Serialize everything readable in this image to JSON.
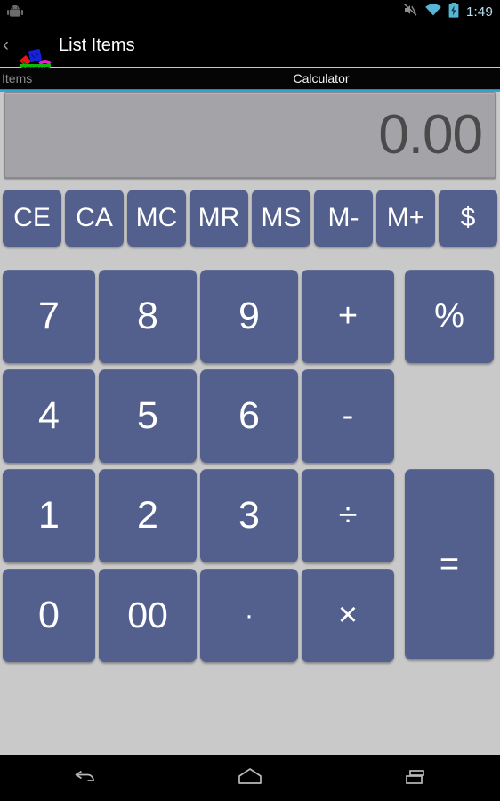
{
  "statusbar": {
    "left_icon": "android-robot-icon",
    "icons": [
      "mute-icon",
      "wifi-icon",
      "battery-charging-icon"
    ],
    "clock": "1:49",
    "clock_color": "#b6e3f5"
  },
  "actionbar": {
    "up_caret": "‹",
    "app_icon": "shopping-basket-icon",
    "title": "List Items",
    "accent_color": "#2ba6d8"
  },
  "tabs": [
    {
      "label": "Items",
      "selected": false
    },
    {
      "label": "Calculator",
      "selected": true
    }
  ],
  "display": {
    "value": "0.00",
    "background": "#a4a4a8",
    "text_color": "#4a4a4a"
  },
  "theme": {
    "button_color": "#535f8c",
    "button_text_color": "#ffffff",
    "page_background": "#c9c9c9"
  },
  "memory_row": [
    {
      "label": "CE",
      "name": "clear-entry-button"
    },
    {
      "label": "CA",
      "name": "clear-all-button"
    },
    {
      "label": "MC",
      "name": "memory-clear-button"
    },
    {
      "label": "MR",
      "name": "memory-recall-button"
    },
    {
      "label": "MS",
      "name": "memory-store-button"
    },
    {
      "label": "M-",
      "name": "memory-subtract-button"
    },
    {
      "label": "M+",
      "name": "memory-add-button"
    },
    {
      "label": "$",
      "name": "currency-button"
    }
  ],
  "keypad": [
    {
      "label": "7",
      "name": "digit-7-button"
    },
    {
      "label": "8",
      "name": "digit-8-button"
    },
    {
      "label": "9",
      "name": "digit-9-button"
    },
    {
      "label": "+",
      "name": "plus-button"
    },
    {
      "label": "%",
      "name": "percent-button"
    },
    {
      "label": "4",
      "name": "digit-4-button"
    },
    {
      "label": "5",
      "name": "digit-5-button"
    },
    {
      "label": "6",
      "name": "digit-6-button"
    },
    {
      "label": "-",
      "name": "minus-button"
    },
    {
      "label": "1",
      "name": "digit-1-button"
    },
    {
      "label": "2",
      "name": "digit-2-button"
    },
    {
      "label": "3",
      "name": "digit-3-button"
    },
    {
      "label": "÷",
      "name": "divide-button"
    },
    {
      "label": "=",
      "name": "equals-button"
    },
    {
      "label": "0",
      "name": "digit-0-button"
    },
    {
      "label": "00",
      "name": "double-zero-button"
    },
    {
      "label": "·",
      "name": "decimal-point-button"
    },
    {
      "label": "×",
      "name": "multiply-button"
    }
  ],
  "navbar": [
    {
      "name": "back-button"
    },
    {
      "name": "home-button"
    },
    {
      "name": "recents-button"
    }
  ]
}
